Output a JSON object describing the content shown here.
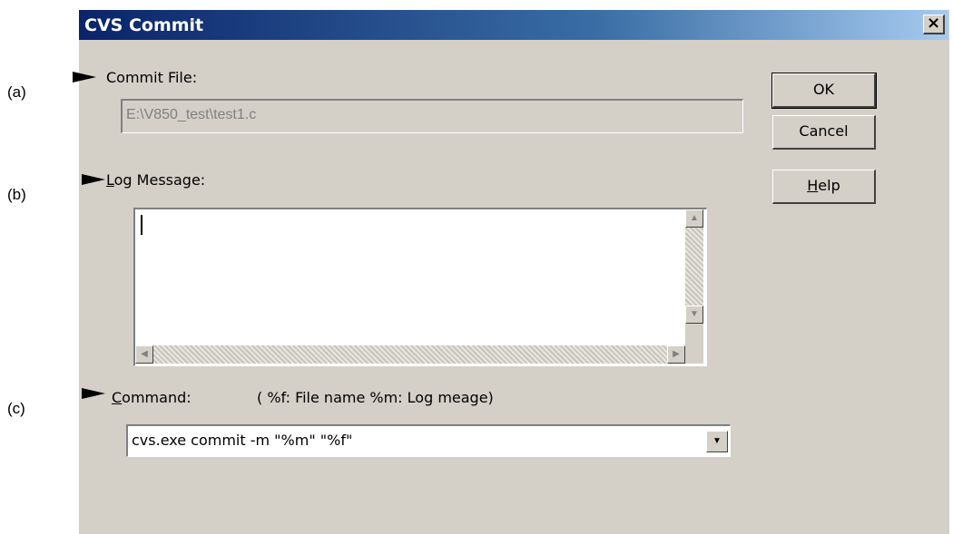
{
  "annotations": {
    "a": "(a)",
    "b": "(b)",
    "c": "(c)"
  },
  "window": {
    "title": "CVS Commit",
    "close_glyph": "×"
  },
  "commit_file": {
    "label": "Commit File:",
    "value": "E:\\V850_test\\test1.c"
  },
  "log_message": {
    "label_mnemonic": "L",
    "label_rest": "og Message:",
    "value": ""
  },
  "command": {
    "label_mnemonic": "C",
    "label_rest": "ommand:",
    "hint": "( %f: File name %m: Log meage)",
    "value": "cvs.exe commit -m \"%m\" \"%f\""
  },
  "buttons": {
    "ok": "OK",
    "cancel": "Cancel",
    "help_mnemonic": "H",
    "help_rest": "elp"
  },
  "icons": {
    "arrow_up": "▲",
    "arrow_down": "▼",
    "arrow_left": "◀",
    "arrow_right": "▶",
    "dropdown": "▼"
  }
}
